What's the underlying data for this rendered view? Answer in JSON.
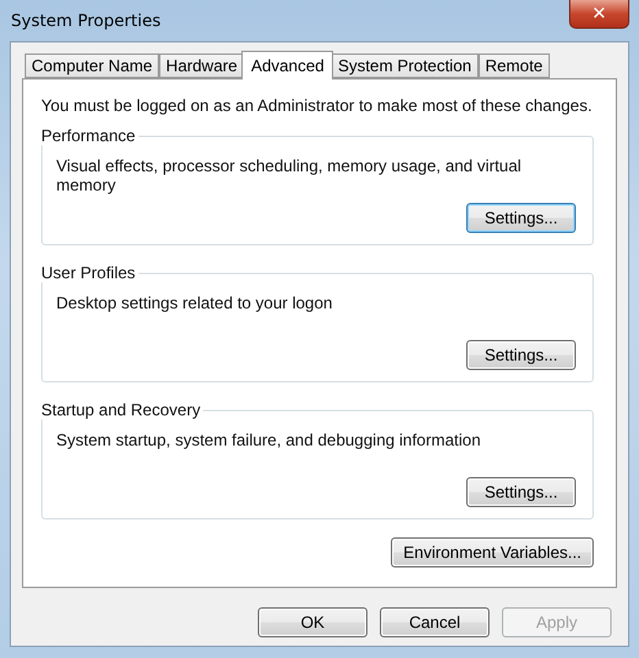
{
  "window": {
    "title": "System Properties",
    "close": "✕"
  },
  "tabs": [
    {
      "label": "Computer Name",
      "selected": false
    },
    {
      "label": "Hardware",
      "selected": false
    },
    {
      "label": "Advanced",
      "selected": true
    },
    {
      "label": "System Protection",
      "selected": false
    },
    {
      "label": "Remote",
      "selected": false
    }
  ],
  "notice": "You must be logged on as an Administrator to make most of these changes.",
  "groups": [
    {
      "title": "Performance",
      "description": "Visual effects, processor scheduling, memory usage, and virtual memory",
      "button": "Settings...",
      "focused": true
    },
    {
      "title": "User Profiles",
      "description": "Desktop settings related to your logon",
      "button": "Settings...",
      "focused": false
    },
    {
      "title": "Startup and Recovery",
      "description": "System startup, system failure, and debugging information",
      "button": "Settings...",
      "focused": false
    }
  ],
  "environment_button": "Environment Variables...",
  "buttons": [
    {
      "label": "OK",
      "disabled": false
    },
    {
      "label": "Cancel",
      "disabled": false
    },
    {
      "label": "Apply",
      "disabled": true
    }
  ]
}
